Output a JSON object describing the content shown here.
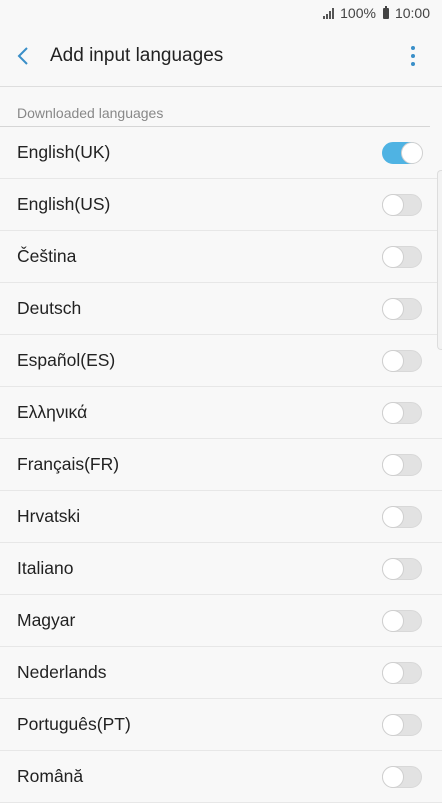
{
  "status_bar": {
    "battery": "100%",
    "time": "10:00"
  },
  "app_bar": {
    "title": "Add input languages",
    "back_icon": "chevron-left-icon",
    "more_icon": "more-vert-icon",
    "accent_color": "#3a8fc8"
  },
  "section": {
    "header": "Downloaded languages"
  },
  "languages": [
    {
      "label": "English(UK)",
      "enabled": true
    },
    {
      "label": "English(US)",
      "enabled": false
    },
    {
      "label": "Čeština",
      "enabled": false
    },
    {
      "label": "Deutsch",
      "enabled": false
    },
    {
      "label": "Español(ES)",
      "enabled": false
    },
    {
      "label": "Ελληνικά",
      "enabled": false
    },
    {
      "label": "Français(FR)",
      "enabled": false
    },
    {
      "label": "Hrvatski",
      "enabled": false
    },
    {
      "label": "Italiano",
      "enabled": false
    },
    {
      "label": "Magyar",
      "enabled": false
    },
    {
      "label": "Nederlands",
      "enabled": false
    },
    {
      "label": "Português(PT)",
      "enabled": false
    },
    {
      "label": "Română",
      "enabled": false
    }
  ],
  "toggle_colors": {
    "on": "#4fb3e3",
    "off": "#e2e2e2"
  }
}
